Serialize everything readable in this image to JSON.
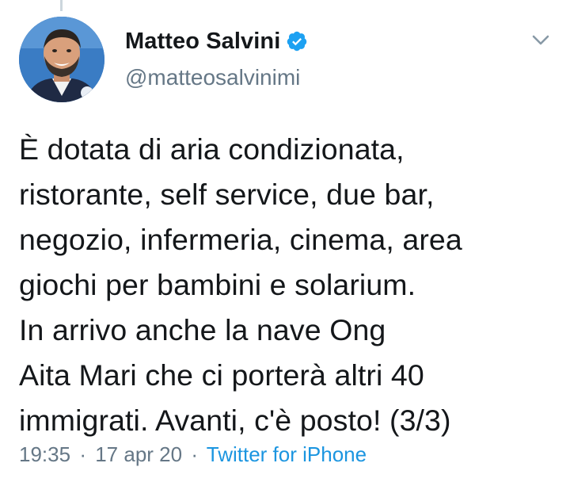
{
  "author": {
    "display_name": "Matteo Salvini",
    "handle": "@matteosalvinimi",
    "verified": true,
    "avatar_icon": "profile-photo"
  },
  "tweet": {
    "text": "È dotata di aria condizionata,\nristorante, self service, due bar,\nnegozio, infermeria, cinema, area\ngiochi per bambini e solarium.\nIn arrivo anche la nave Ong\nAita Mari che ci porterà altri 40\nimmigrati. Avanti, c'è posto! (3/3)"
  },
  "meta": {
    "time": "19:35",
    "date": "17 apr 20",
    "separator": "·",
    "source": "Twitter for iPhone"
  },
  "colors": {
    "verified_badge": "#1da1f2",
    "link": "#1b95e0",
    "secondary_text": "#657786"
  },
  "icons": {
    "menu": "chevron-down-icon",
    "verified": "verified-badge-icon"
  }
}
